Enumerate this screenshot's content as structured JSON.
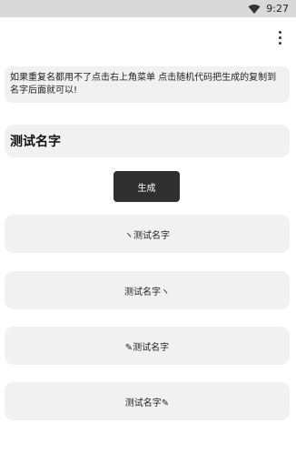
{
  "status_bar": {
    "time": "9:27",
    "wifi_icon": "wifi-icon"
  },
  "toolbar": {
    "overflow_icon": "more-vertical-icon"
  },
  "notice": {
    "text": "如果重复名都用不了点击右上角菜单 点击随机代码把生成的复制到名字后面就可以!"
  },
  "name_input": {
    "value": "测试名字"
  },
  "generate_button": {
    "label": "生成"
  },
  "results": [
    {
      "text": "ヽ测试名字"
    },
    {
      "text": "测试名字ヽ"
    },
    {
      "text": "✎测试名字"
    },
    {
      "text": "测试名字✎"
    }
  ]
}
